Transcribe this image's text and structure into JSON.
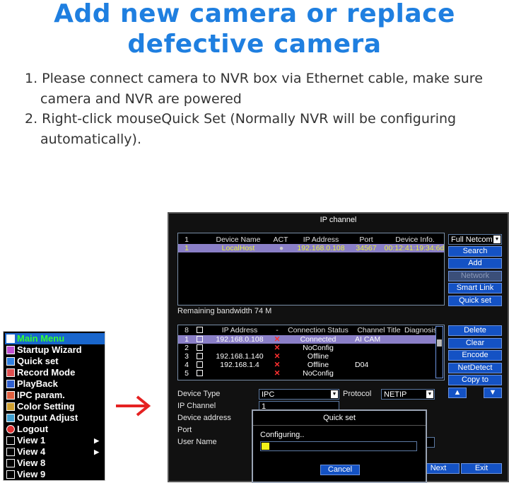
{
  "heading": {
    "line1": "Add new camera or replace",
    "line2": "defective camera"
  },
  "steps": [
    "1. Please connect camera to NVR box via Ethernet cable, make sure camera and NVR are powered",
    "2. Right-click mouseQuick Set (Normally NVR will be configuring automatically)."
  ],
  "menu": {
    "items": [
      {
        "label": "Main Menu",
        "icon": "home-icon",
        "selected": true
      },
      {
        "label": "Startup Wizard",
        "icon": "wizard-icon"
      },
      {
        "label": "Quick set",
        "icon": "quick-set-icon"
      },
      {
        "label": "Record Mode",
        "icon": "record-icon"
      },
      {
        "label": "PlayBack",
        "icon": "playback-icon"
      },
      {
        "label": "IPC param.",
        "icon": "ipc-icon"
      },
      {
        "label": "Color Setting",
        "icon": "color-icon"
      },
      {
        "label": "Output Adjust",
        "icon": "output-icon"
      },
      {
        "label": "Logout",
        "icon": "power-icon"
      },
      {
        "label": "View 1",
        "icon": "view1-icon",
        "submenu": true
      },
      {
        "label": "View 4",
        "icon": "view4-icon",
        "submenu": true
      },
      {
        "label": "View 8",
        "icon": "view8-icon"
      },
      {
        "label": "View 9",
        "icon": "view9-icon"
      }
    ]
  },
  "nvr": {
    "title": "IP channel",
    "top_table": {
      "headers": [
        "1",
        "Device Name",
        "ACT",
        "IP Address",
        "Port",
        "Device Info."
      ],
      "rows": [
        [
          "1",
          "LocalHost",
          "",
          "192.168.0.108",
          "34567",
          "00:12:41:19:34:6d"
        ]
      ]
    },
    "protocol_select": "Full Netcom",
    "top_buttons": {
      "search": "Search",
      "add": "Add",
      "network": "Network",
      "smart_link": "Smart Link",
      "quick_set": "Quick set"
    },
    "remaining_bandwidth": "Remaining bandwidth  74 M",
    "channel_table": {
      "headers": [
        "8",
        "IP Address",
        "-",
        "Connection Status",
        "Channel Title",
        "Diagnosis"
      ],
      "rows": [
        {
          "num": "1",
          "ip": "192.168.0.108",
          "status": "Connected",
          "title": "AI CAM"
        },
        {
          "num": "2",
          "ip": "",
          "status": "NoConfig",
          "title": ""
        },
        {
          "num": "3",
          "ip": "192.168.1.140",
          "status": "Offline",
          "title": ""
        },
        {
          "num": "4",
          "ip": "192.168.1.4",
          "status": "Offline",
          "title": "D04"
        },
        {
          "num": "5",
          "ip": "",
          "status": "NoConfig",
          "title": ""
        }
      ]
    },
    "right_buttons": {
      "delete": "Delete",
      "clear": "Clear",
      "encode": "Encode",
      "netdetect": "NetDetect",
      "copy_to": "Copy to"
    },
    "form": {
      "device_type_label": "Device Type",
      "device_type_value": "IPC",
      "protocol_label": "Protocol",
      "protocol_value": "NETIP",
      "ip_channel_label": "IP Channel",
      "ip_channel_value": "1",
      "device_address_label": "Device address",
      "port_label": "Port",
      "user_name_label": "User Name"
    },
    "bottom_buttons": {
      "next": "Next",
      "exit": "Exit"
    },
    "dialog": {
      "title": "Quick set",
      "status": "Configuring..",
      "progress": 0.05,
      "cancel": "Cancel"
    }
  }
}
